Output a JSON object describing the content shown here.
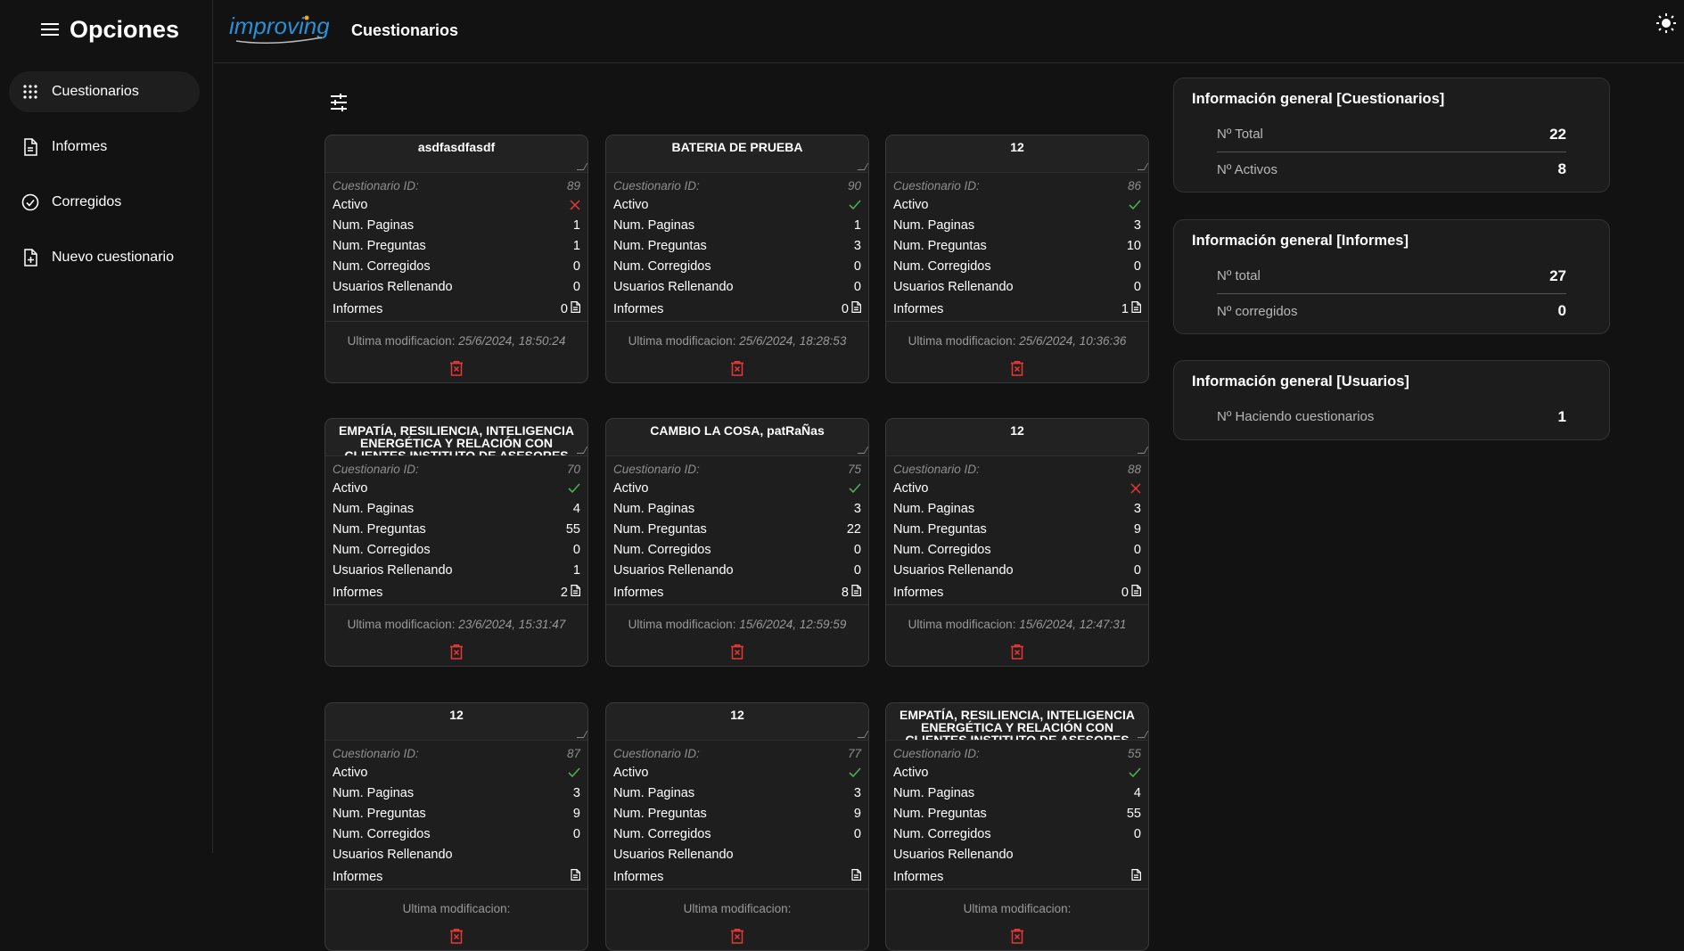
{
  "sidebar": {
    "title": "Opciones",
    "items": [
      {
        "label": "Cuestionarios",
        "icon": "grid-icon"
      },
      {
        "label": "Informes",
        "icon": "document-icon"
      },
      {
        "label": "Corregidos",
        "icon": "check-circle-icon"
      },
      {
        "label": "Nuevo cuestionario",
        "icon": "add-document-icon"
      }
    ]
  },
  "header": {
    "logo_text": "improving",
    "title": "Cuestionarios"
  },
  "labels": {
    "id": "Cuestionario ID:",
    "activo": "Activo",
    "paginas": "Num. Paginas",
    "preguntas": "Num. Preguntas",
    "corregidos": "Num. Corregidos",
    "rellenando": "Usuarios Rellenando",
    "informes": "Informes",
    "modificacion": "Ultima modificacion:"
  },
  "cards": [
    {
      "title": "asdfasdfasdf",
      "id": "89",
      "activo": false,
      "paginas": "1",
      "preguntas": "1",
      "corregidos": "0",
      "rellenando": "0",
      "informes": "0",
      "modificado": "25/6/2024, 18:50:24"
    },
    {
      "title": "BATERIA DE PRUEBA",
      "id": "90",
      "activo": true,
      "paginas": "1",
      "preguntas": "3",
      "corregidos": "0",
      "rellenando": "0",
      "informes": "0",
      "modificado": "25/6/2024, 18:28:53"
    },
    {
      "title": "12",
      "id": "86",
      "activo": true,
      "paginas": "3",
      "preguntas": "10",
      "corregidos": "0",
      "rellenando": "0",
      "informes": "1",
      "modificado": "25/6/2024, 10:36:36"
    },
    {
      "title": "EMPATÍA, RESILIENCIA, INTELIGENCIA ENERGÉTICA Y RELACIÓN CON CLIENTES INSTITUTO DE ASESORES IMPROVING",
      "id": "70",
      "activo": true,
      "paginas": "4",
      "preguntas": "55",
      "corregidos": "0",
      "rellenando": "1",
      "informes": "2",
      "modificado": "23/6/2024, 15:31:47"
    },
    {
      "title": "CAMBIO LA COSA, patRaÑas",
      "id": "75",
      "activo": true,
      "paginas": "3",
      "preguntas": "22",
      "corregidos": "0",
      "rellenando": "0",
      "informes": "8",
      "modificado": "15/6/2024, 12:59:59"
    },
    {
      "title": "12",
      "id": "88",
      "activo": false,
      "paginas": "3",
      "preguntas": "9",
      "corregidos": "0",
      "rellenando": "0",
      "informes": "0",
      "modificado": "15/6/2024, 12:47:31"
    },
    {
      "title": "12",
      "id": "87",
      "activo": true,
      "paginas": "3",
      "preguntas": "9",
      "corregidos": "0",
      "rellenando": "",
      "informes": "",
      "modificado": ""
    },
    {
      "title": "12",
      "id": "77",
      "activo": true,
      "paginas": "3",
      "preguntas": "9",
      "corregidos": "0",
      "rellenando": "",
      "informes": "",
      "modificado": ""
    },
    {
      "title": "EMPATÍA, RESILIENCIA, INTELIGENCIA ENERGÉTICA Y RELACIÓN CON CLIENTES INSTITUTO DE ASESORES IMPROVING",
      "id": "55",
      "activo": true,
      "paginas": "4",
      "preguntas": "55",
      "corregidos": "0",
      "rellenando": "",
      "informes": "",
      "modificado": ""
    }
  ],
  "info_panels": [
    {
      "title": "Información general [Cuestionarios]",
      "rows": [
        {
          "label": "Nº Total",
          "value": "22"
        },
        {
          "label": "Nº Activos",
          "value": "8"
        }
      ]
    },
    {
      "title": "Información general [Informes]",
      "rows": [
        {
          "label": "Nº total",
          "value": "27"
        },
        {
          "label": "Nº corregidos",
          "value": "0"
        }
      ]
    },
    {
      "title": "Información general [Usuarios]",
      "rows": [
        {
          "label": "Nº Haciendo cuestionarios",
          "value": "1"
        }
      ]
    }
  ],
  "colors": {
    "active": "#4caf50",
    "inactive": "#e53935",
    "delete": "#e53935",
    "logo": "#2a8fd6"
  }
}
